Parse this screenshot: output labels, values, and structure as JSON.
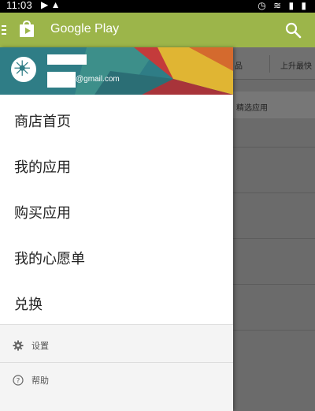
{
  "status_bar": {
    "time": "11:03",
    "left_icons": "▶ ▲",
    "right_icons": "◷ ≋ ▮ ▮"
  },
  "app_bar": {
    "title": "Google Play"
  },
  "background": {
    "tab_1": "品",
    "tab_2": "上升最快",
    "banner": "精选应用"
  },
  "drawer": {
    "account": {
      "email": "@gmail.com"
    },
    "menu": [
      {
        "label": "商店首页"
      },
      {
        "label": "我的应用"
      },
      {
        "label": "购买应用"
      },
      {
        "label": "我的心愿单"
      },
      {
        "label": "兑换"
      }
    ],
    "secondary": [
      {
        "label": "设置",
        "icon": "gear-icon"
      },
      {
        "label": "帮助",
        "icon": "help-icon"
      }
    ]
  },
  "colors": {
    "accent": "#9cb54a",
    "header_teal": "#2f7d86",
    "overlay": "#6b6b6b"
  }
}
